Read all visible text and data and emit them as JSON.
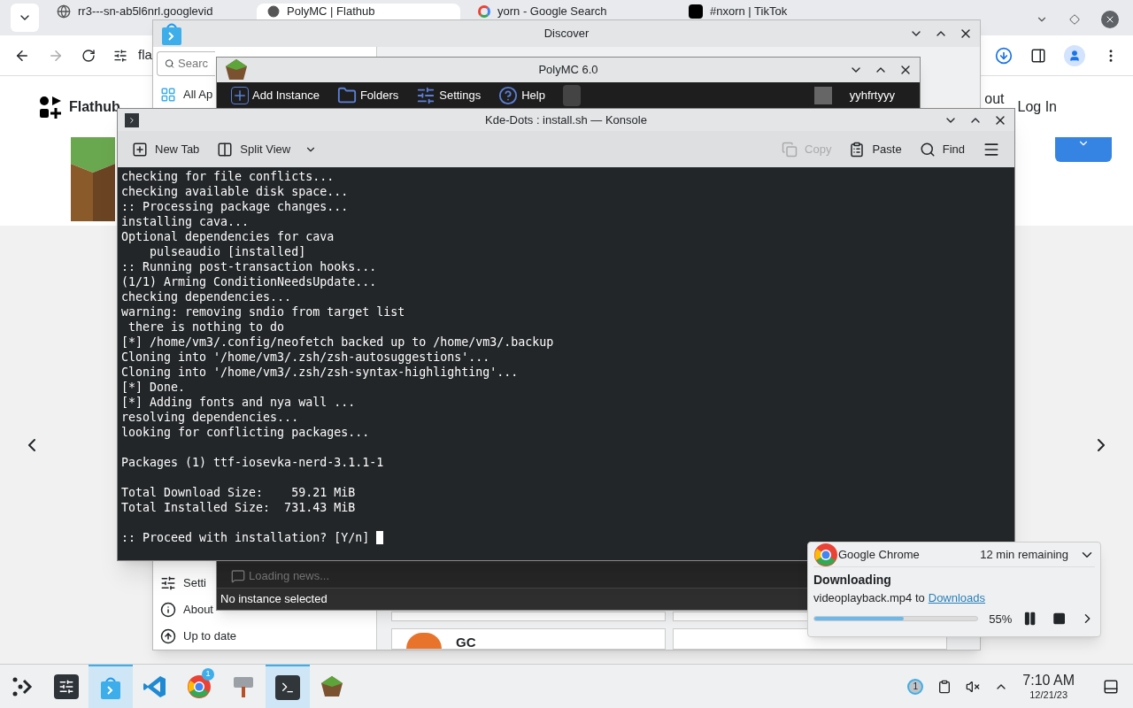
{
  "browser": {
    "tabs": [
      {
        "title": "rr3---sn-ab5l6nrl.googlevid",
        "kind": "globe",
        "selected": false
      },
      {
        "title": "PolyMC | Flathub",
        "kind": "flathub",
        "selected": true
      },
      {
        "title": "yorn - Google Search",
        "kind": "google",
        "selected": false
      },
      {
        "title": "#nxorn | TikTok",
        "kind": "tiktok",
        "selected": false
      }
    ],
    "address": "fla",
    "brand": "Flathub",
    "nav_link": "out",
    "login": "Log In"
  },
  "discover": {
    "title": "Discover",
    "search_placeholder": "Searc",
    "category": "All Ap",
    "sidebar": [
      {
        "label": "Setti",
        "kind": "settings"
      },
      {
        "label": "About",
        "kind": "about"
      },
      {
        "label": "Up to date",
        "kind": "update"
      }
    ],
    "card_title": "GC"
  },
  "polymc": {
    "title": "PolyMC 6.0",
    "toolbar": [
      {
        "label": "Add Instance",
        "kind": "add"
      },
      {
        "label": "Folders",
        "kind": "folder"
      },
      {
        "label": "Settings",
        "kind": "settings"
      },
      {
        "label": "Help",
        "kind": "help"
      }
    ],
    "account": "yyhfrtyyy",
    "news": "Loading news...",
    "status": "No instance selected"
  },
  "konsole": {
    "title": "Kde-Dots : install.sh — Konsole",
    "toolbar": [
      {
        "label": "New Tab",
        "kind": "newtab",
        "disabled": false
      },
      {
        "label": "Split View",
        "kind": "split",
        "disabled": false
      },
      {
        "label": "Copy",
        "kind": "copy",
        "disabled": true
      },
      {
        "label": "Paste",
        "kind": "paste",
        "disabled": false
      },
      {
        "label": "Find",
        "kind": "find",
        "disabled": false
      }
    ],
    "blocks": [
      [
        "checking for file conflicts...",
        "checking available disk space...",
        ":: Processing package changes...",
        "installing cava...",
        "Optional dependencies for cava",
        "    pulseaudio [installed]",
        ":: Running post-transaction hooks...",
        "(1/1) Arming ConditionNeedsUpdate...",
        "checking dependencies...",
        "warning: removing sndio from target list",
        " there is nothing to do",
        "[*] /home/vm3/.config/neofetch backed up to /home/vm3/.backup",
        "Cloning into '/home/vm3/.zsh/zsh-autosuggestions'...",
        "Cloning into '/home/vm3/.zsh/zsh-syntax-highlighting'...",
        "[*] Done.",
        "[*] Adding fonts and nya wall ...",
        "resolving dependencies...",
        "looking for conflicting packages..."
      ],
      [
        "Packages (1) ttf-iosevka-nerd-3.1.1-1"
      ],
      [
        "Total Download Size:    59.21 MiB",
        "Total Installed Size:  731.43 MiB"
      ],
      [
        ":: Proceed with installation? [Y/n]"
      ]
    ],
    "cursor": true
  },
  "notification": {
    "app": "Google Chrome",
    "remaining": "12 min remaining",
    "heading": "Downloading",
    "body": "videoplayback.mp4 to",
    "link": "Downloads",
    "level": 0.55,
    "percent": "55%"
  },
  "taskbar": {
    "apps": [
      {
        "kind": "launcher",
        "active": false
      },
      {
        "kind": "settings",
        "active": false
      },
      {
        "kind": "discover",
        "active": true
      },
      {
        "kind": "editor",
        "active": false
      },
      {
        "kind": "chrome",
        "active": false,
        "badge": "1"
      },
      {
        "kind": "tool",
        "active": false
      },
      {
        "kind": "konsole",
        "active": true
      },
      {
        "kind": "polymc",
        "active": false
      }
    ],
    "tray_badge": "1",
    "time": "7:10 AM",
    "date": "12/21/23"
  }
}
